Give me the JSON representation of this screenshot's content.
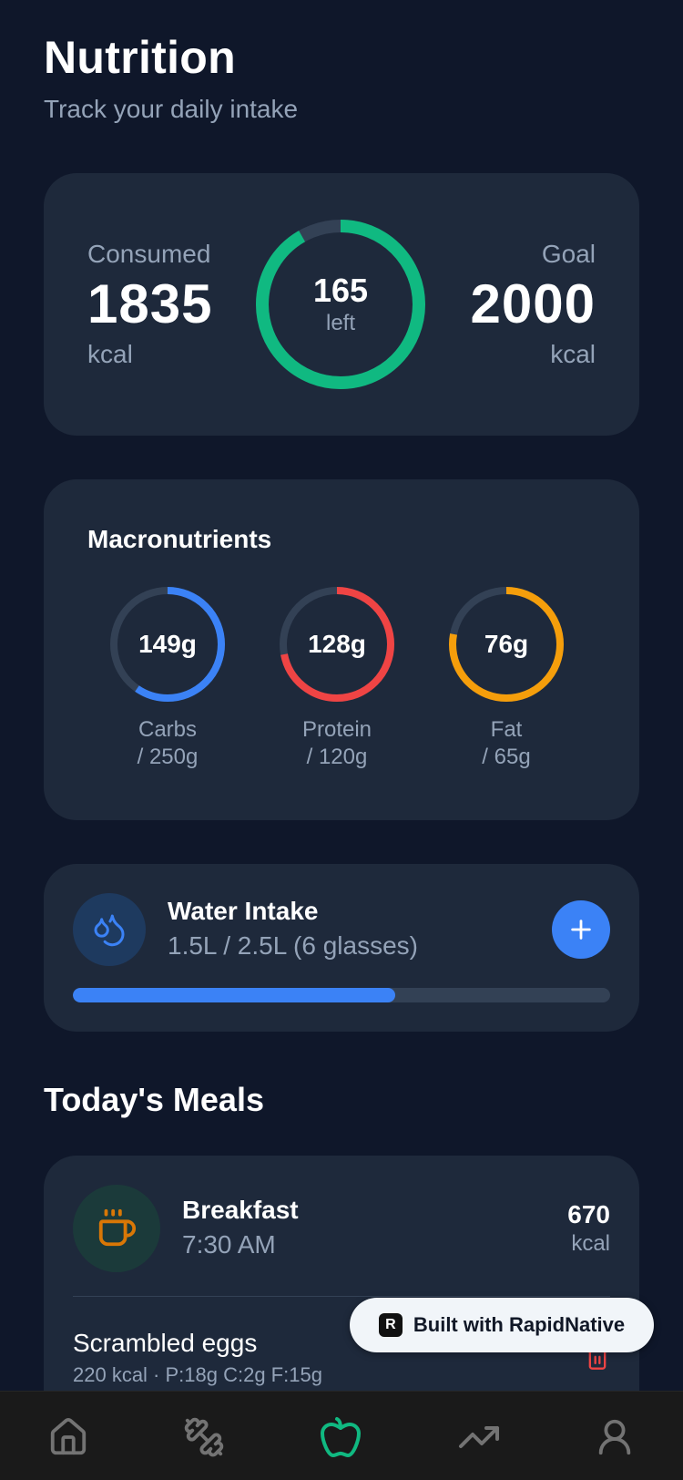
{
  "header": {
    "title": "Nutrition",
    "subtitle": "Track your daily intake"
  },
  "calories": {
    "consumed_label": "Consumed",
    "consumed_value": "1835",
    "consumed_unit": "kcal",
    "left_value": "165",
    "left_label": "left",
    "goal_label": "Goal",
    "goal_value": "2000",
    "goal_unit": "kcal",
    "progress_fraction": 0.9175,
    "ring_color": "#10b981"
  },
  "macros": {
    "title": "Macronutrients",
    "items": [
      {
        "value": "149g",
        "name": "Carbs",
        "goal": "/ 250g",
        "progress": 0.596,
        "color": "#3b82f6"
      },
      {
        "value": "128g",
        "name": "Protein",
        "goal": "/ 120g",
        "progress": 0.72,
        "color": "#ef4444"
      },
      {
        "value": "76g",
        "name": "Fat",
        "goal": "/ 65g",
        "progress": 0.78,
        "color": "#f59e0b"
      }
    ]
  },
  "water": {
    "title": "Water Intake",
    "subtitle": "1.5L / 2.5L (6 glasses)",
    "progress": 0.6,
    "icon": "water-drops-icon",
    "add_icon": "plus-icon"
  },
  "meals": {
    "section_title": "Today's Meals",
    "items": [
      {
        "name": "Breakfast",
        "time": "7:30 AM",
        "kcal": "670",
        "kcal_unit": "kcal",
        "icon": "coffee-cup-icon",
        "foods": [
          {
            "name": "Scrambled eggs",
            "detail": "220 kcal · P:18g C:2g F:15g"
          }
        ]
      }
    ]
  },
  "badge": {
    "text": "Built with RapidNative",
    "logo": "R"
  },
  "tabs": [
    {
      "name": "home",
      "icon": "home-icon",
      "active": false
    },
    {
      "name": "workouts",
      "icon": "dumbbell-icon",
      "active": false
    },
    {
      "name": "nutrition",
      "icon": "apple-icon",
      "active": true
    },
    {
      "name": "progress",
      "icon": "trending-up-icon",
      "active": false
    },
    {
      "name": "profile",
      "icon": "user-icon",
      "active": false
    }
  ],
  "colors": {
    "background": "#0f172a",
    "card": "#1e293b",
    "accent_green": "#10b981",
    "accent_blue": "#3b82f6",
    "muted_text": "#94a3b8"
  }
}
